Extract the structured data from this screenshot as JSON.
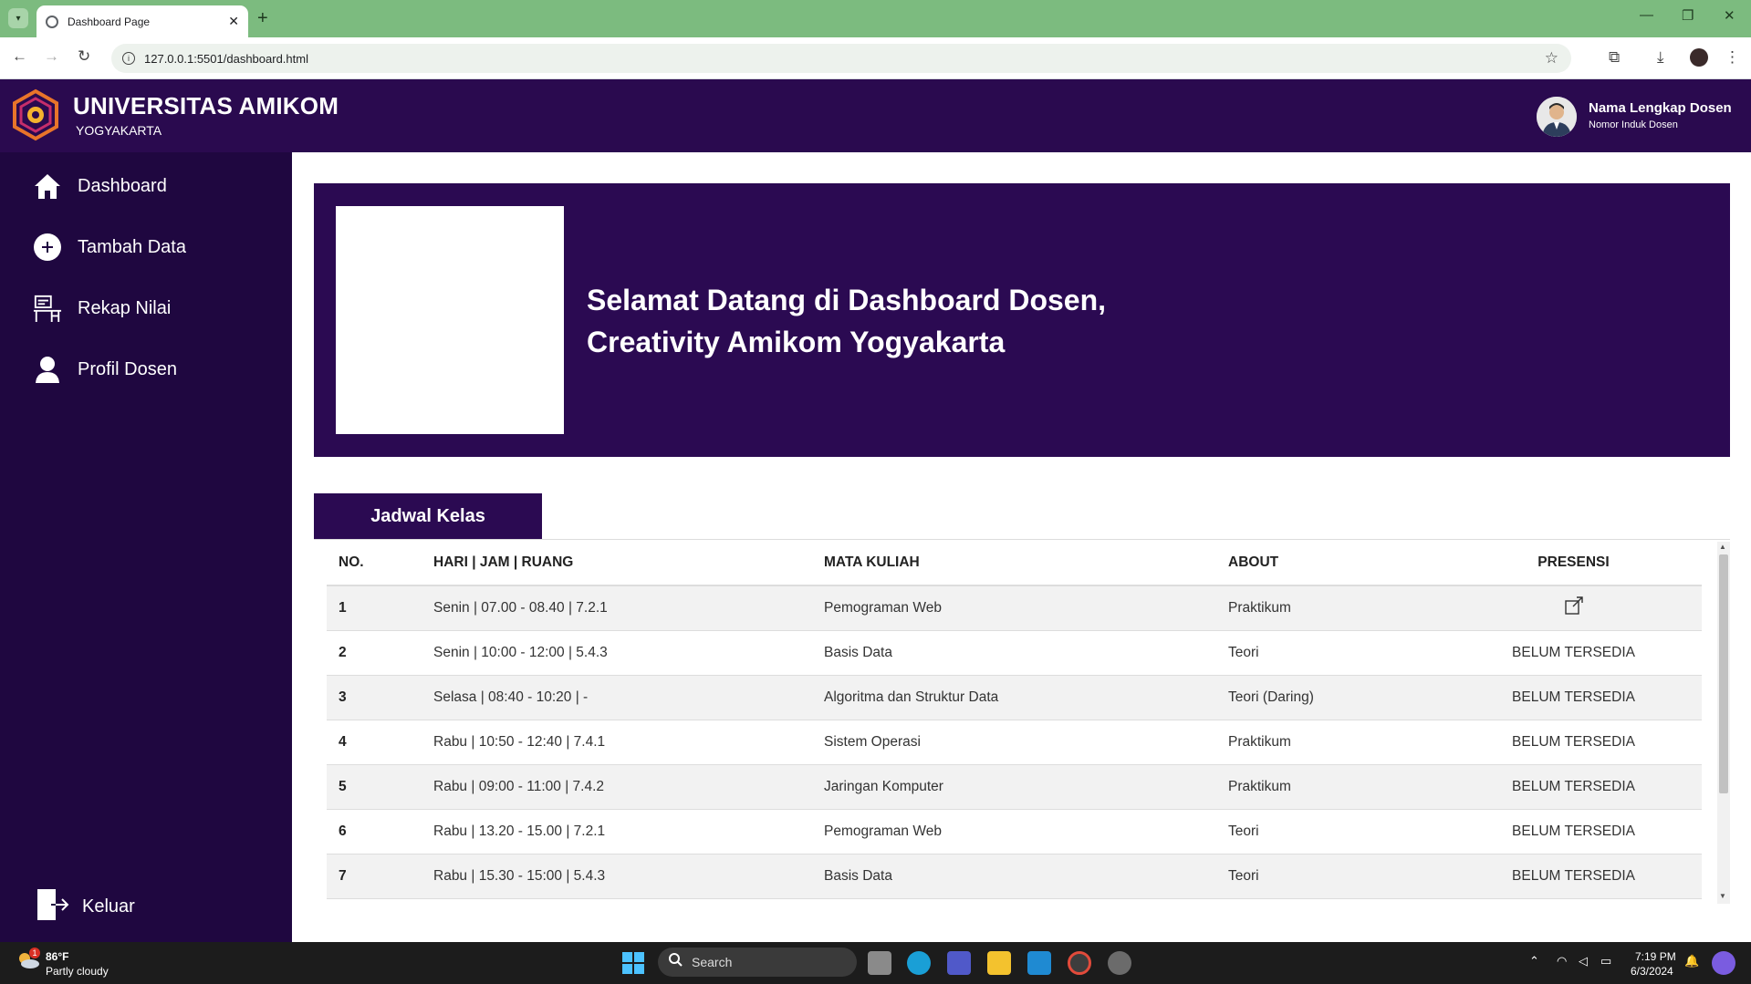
{
  "browser": {
    "tab_title": "Dashboard Page",
    "url": "127.0.0.1:5501/dashboard.html"
  },
  "header": {
    "brand_name": "UNIVERSITAS AMIKOM",
    "brand_sub": "YOGYAKARTA",
    "user_name": "Nama Lengkap Dosen",
    "user_id": "Nomor Induk Dosen"
  },
  "sidebar": {
    "items": [
      {
        "label": "Dashboard",
        "icon": "home-icon"
      },
      {
        "label": "Tambah Data",
        "icon": "plus-circle-icon"
      },
      {
        "label": "Rekap Nilai",
        "icon": "desk-icon"
      },
      {
        "label": "Profil Dosen",
        "icon": "user-icon"
      }
    ],
    "logout_label": "Keluar"
  },
  "banner": {
    "line1": "Selamat Datang di Dashboard Dosen,",
    "line2": "Creativity Amikom Yogyakarta"
  },
  "schedule": {
    "tab_label": "Jadwal Kelas",
    "headers": [
      "NO.",
      "HARI | JAM | RUANG",
      "MATA KULIAH",
      "ABOUT",
      "PRESENSI"
    ],
    "rows": [
      {
        "no": "1",
        "time": "Senin | 07.00 - 08.40 | 7.2.1",
        "course": "Pemograman Web",
        "about": "Praktikum",
        "presensi": ""
      },
      {
        "no": "2",
        "time": "Senin | 10:00 - 12:00 | 5.4.3",
        "course": "Basis Data",
        "about": "Teori",
        "presensi": "BELUM TERSEDIA"
      },
      {
        "no": "3",
        "time": "Selasa | 08:40 - 10:20 | -",
        "course": "Algoritma dan Struktur Data",
        "about": "Teori (Daring)",
        "presensi": "BELUM TERSEDIA"
      },
      {
        "no": "4",
        "time": "Rabu | 10:50 - 12:40 | 7.4.1",
        "course": "Sistem Operasi",
        "about": "Praktikum",
        "presensi": "BELUM TERSEDIA"
      },
      {
        "no": "5",
        "time": "Rabu | 09:00 - 11:00 | 7.4.2",
        "course": "Jaringan Komputer",
        "about": "Praktikum",
        "presensi": "BELUM TERSEDIA"
      },
      {
        "no": "6",
        "time": "Rabu | 13.20 - 15.00 | 7.2.1",
        "course": "Pemograman Web",
        "about": "Teori",
        "presensi": "BELUM TERSEDIA"
      },
      {
        "no": "7",
        "time": "Rabu | 15.30 - 15:00 | 5.4.3",
        "course": "Basis Data",
        "about": "Teori",
        "presensi": "BELUM TERSEDIA"
      }
    ]
  },
  "taskbar": {
    "weather_badge": "1",
    "weather_temp": "86°F",
    "weather_desc": "Partly cloudy",
    "search_label": "Search",
    "time": "7:19 PM",
    "date": "6/3/2024"
  },
  "colors": {
    "header_bg": "#2a0a4f",
    "sidebar_bg": "#1f0740",
    "banner_bg": "#2b0a52",
    "browser_frame": "#7cbb7f"
  }
}
